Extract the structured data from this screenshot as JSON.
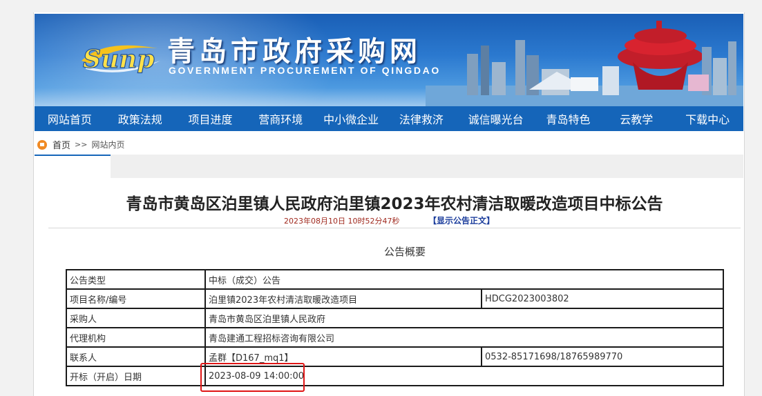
{
  "header": {
    "logo_text": "Sunp",
    "site_title": "青岛市政府采购网",
    "site_subtitle": "GOVERNMENT PROCUREMENT OF QINGDAO"
  },
  "nav": {
    "items": [
      "网站首页",
      "政策法规",
      "项目进度",
      "营商环境",
      "中小微企业",
      "法律救济",
      "诚信曝光台",
      "青岛特色",
      "云教学",
      "下载中心"
    ]
  },
  "breadcrumb": {
    "home": "首页",
    "separator": ">>",
    "current": "网站内页"
  },
  "article": {
    "title": "青岛市黄岛区泊里镇人民政府泊里镇2023年农村清洁取暖改造项目中标公告",
    "published": "2023年08月10日 10时52分47秒",
    "show_full_link": "【显示公告正文】",
    "section_title": "公告概要"
  },
  "summary_table": {
    "rows": [
      {
        "label": "公告类型",
        "value": "中标（成交）公告",
        "extra": ""
      },
      {
        "label": "项目名称/编号",
        "value": "泊里镇2023年农村清洁取暖改造项目",
        "extra": "HDCG2023003802"
      },
      {
        "label": "采购人",
        "value": "青岛市黄岛区泊里镇人民政府",
        "extra": ""
      },
      {
        "label": "代理机构",
        "value": "青岛建通工程招标咨询有限公司",
        "extra": ""
      },
      {
        "label": "联系人",
        "value": "孟群【D167_mq1】",
        "extra": "0532-85171698/18765989770"
      },
      {
        "label": "开标（开启）日期",
        "value": "2023-08-09 14:00:00",
        "extra": ""
      }
    ]
  },
  "colors": {
    "nav_bg": "#1565b9",
    "meta_red": "#a0291e",
    "link_blue": "#1b3d9c",
    "highlight_red": "#e01515"
  }
}
